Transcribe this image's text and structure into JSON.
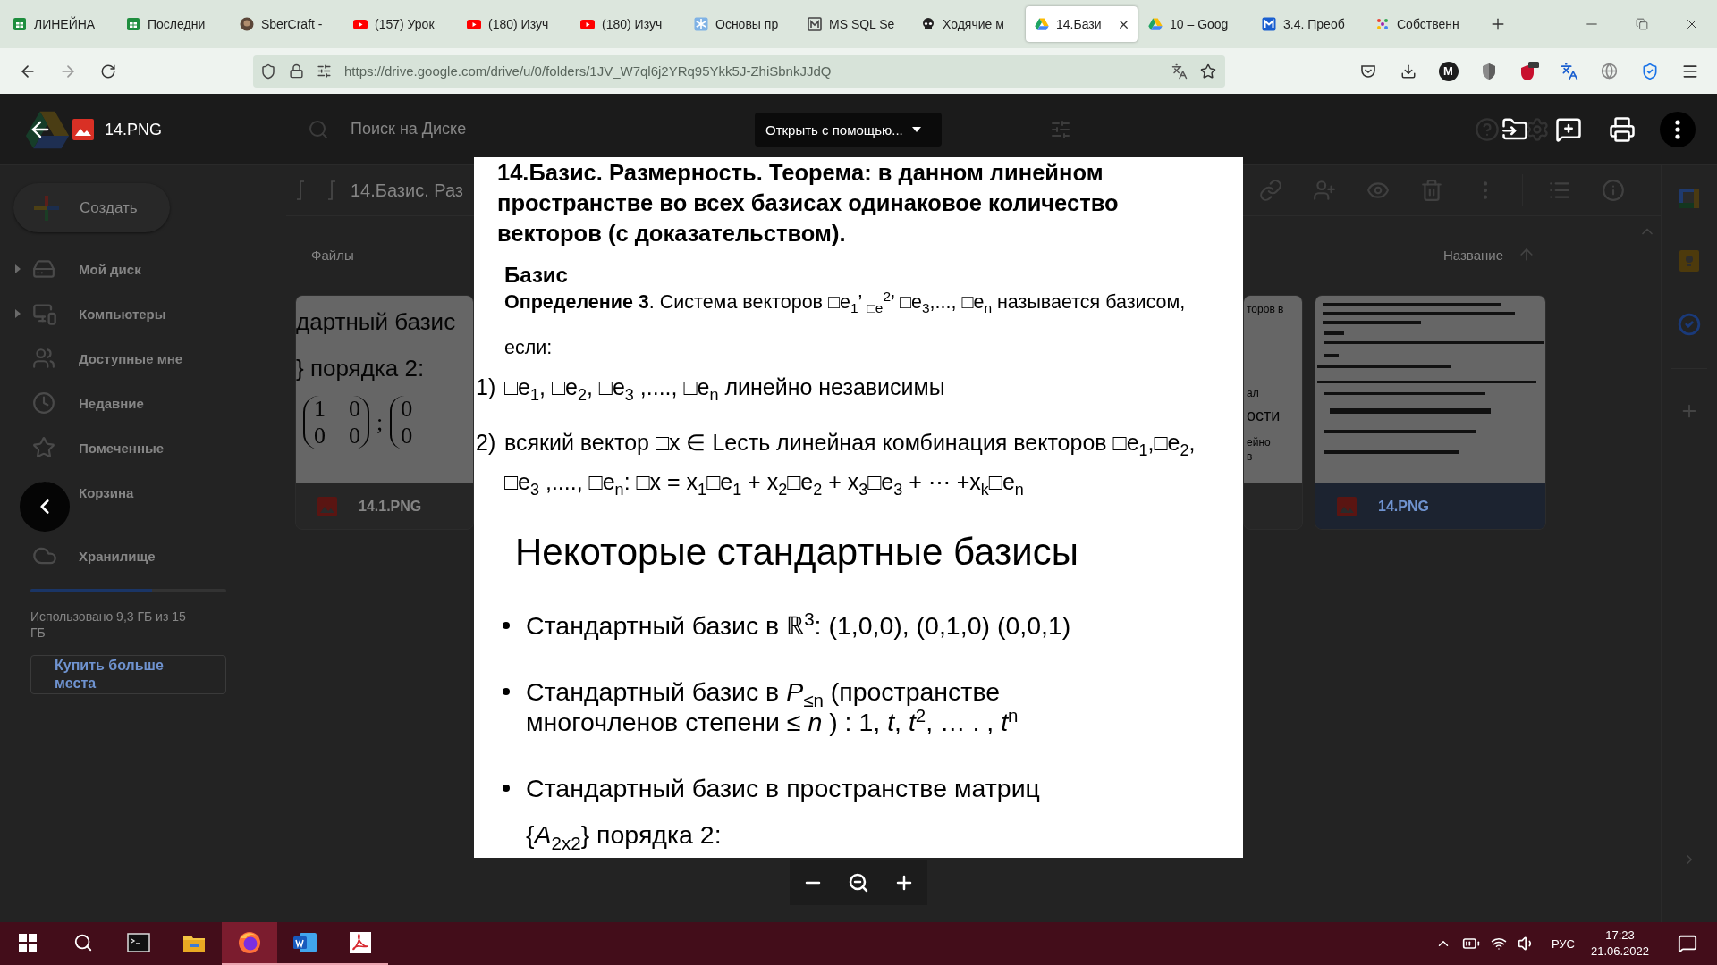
{
  "browser": {
    "tabs": [
      {
        "title": "ЛИНЕЙНА",
        "kind": "sheets",
        "selected": false
      },
      {
        "title": "Последни",
        "kind": "sheets",
        "selected": false
      },
      {
        "title": "SberCraft -",
        "kind": "avatar",
        "selected": false
      },
      {
        "title": "(157) Урок",
        "kind": "video",
        "selected": false
      },
      {
        "title": "(180) Изуч",
        "kind": "video",
        "selected": false
      },
      {
        "title": "(180) Изуч",
        "kind": "video",
        "selected": false
      },
      {
        "title": "Основы пр",
        "kind": "snowflake",
        "selected": false
      },
      {
        "title": "MS SQL Se",
        "kind": "database",
        "selected": false
      },
      {
        "title": "Ходячие м",
        "kind": "skull",
        "selected": false
      },
      {
        "title": "14.Бази",
        "kind": "drive",
        "selected": true
      },
      {
        "title": "10 – Goog",
        "kind": "drive",
        "selected": false
      },
      {
        "title": "3.4. Преоб",
        "kind": "book",
        "selected": false
      },
      {
        "title": "Собственн",
        "kind": "dots",
        "selected": false
      }
    ],
    "url": "https://drive.google.com/drive/u/0/folders/1JV_W7ql6j2YRq95Ykk5J-ZhiSbnkJJdQ",
    "profile_letter": "M"
  },
  "drive": {
    "search": {
      "placeholder": "Поиск на Диске"
    },
    "create_button": "Создать",
    "nav": [
      {
        "label": "Мой диск",
        "kind": "drive",
        "expandable": true
      },
      {
        "label": "Компьютеры",
        "kind": "computers",
        "expandable": true
      },
      {
        "label": "Доступные мне",
        "kind": "shared",
        "expandable": false
      },
      {
        "label": "Недавние",
        "kind": "recent",
        "expandable": false
      },
      {
        "label": "Помеченные",
        "kind": "starred",
        "expandable": false
      },
      {
        "label": "Корзина",
        "kind": "trash",
        "expandable": false
      }
    ],
    "storage": {
      "label": "Хранилище",
      "level": 0.62,
      "usage": "Использовано 9,3 ГБ из 15 ГБ",
      "buy_button": "Купить больше места"
    },
    "folder_title": "14.Базис. Раз",
    "section_label": "Файлы",
    "sort_label": "Название",
    "files": [
      {
        "name": "14.1.PNG",
        "selected": false,
        "preview": {
          "lines": [
            "дартный  базис",
            "} порядка 2:"
          ],
          "matrices": [
            [
              [
                "1",
                "0"
              ],
              [
                "0",
                "0"
              ]
            ],
            [
              [
                "0"
              ],
              [
                "0"
              ]
            ]
          ],
          "separator": ";"
        }
      },
      {
        "name": "14.PNG",
        "selected": true
      }
    ],
    "partial_card": {
      "fragments": [
        {
          "text": "торов в",
          "kind": "small"
        },
        {
          "text": "ал",
          "kind": "small"
        },
        {
          "text": "ости",
          "kind": "large"
        },
        {
          "text": "ейно",
          "kind": "small"
        },
        {
          "text": "в",
          "kind": "small"
        }
      ]
    }
  },
  "viewer": {
    "file_name": "14.PNG",
    "open_with": "Открыть с помощью...",
    "document": {
      "title": "14.Базис. Размерность. Теорема: в данном линейном пространстве во всех базисах одинаковое количество векторов (с доказательством).",
      "heading": "Базис",
      "definition": "**Определение 3**. Система векторов □e$_{1}$’ $_{□e}$$^{2}$’ □e$_{3}$,..., □e$_{n}$ называется базисом,",
      "condition": "если:",
      "items": [
        {
          "marker": "1)",
          "lines": [
            "□e$_{1}$, □e$_{2}$, □e$_{3}$ ,...., □e$_{n}$ линейно независимы"
          ]
        },
        {
          "marker": "2)",
          "lines": [
            "всякий вектор □x ∈  Lесть линейная комбинация векторов □e$_{1}$,□e$_{2}$,",
            "□e$_{3}$ ,...., □e$_{n}$: □x = x$_{1}$□e$_{1}$ + x$_{2}$□e$_{2}$ + x$_{3}$□e$_{3}$ + ⋯  +x$_{k}$□e$_{n}$"
          ]
        }
      ],
      "slide_title": "Некоторые стандартные базисы",
      "bullets": [
        {
          "kind": "bullet",
          "lines": [
            "Стандартный базис в ℝ$^{3}$: (1,0,0), (0,1,0) (0,0,1)"
          ]
        },
        {
          "kind": "bullet",
          "lines": [
            "Стандартный базис в *P*$_{≤n}$ (пространстве",
            "многочленов степени ≤ *n* ) :  1, *t*, *t*$^{2}$, … . , *t*$^{n}$"
          ]
        },
        {
          "kind": "bullet",
          "lines": [
            "Стандартный  базис в пространстве матриц"
          ]
        },
        {
          "kind": "continuation",
          "lines": [
            "{*A*$_{2x2}$} порядка 2:"
          ]
        }
      ]
    }
  },
  "taskbar": {
    "apps": [
      {
        "kind": "terminal",
        "running": false,
        "selected": false
      },
      {
        "kind": "explorer",
        "running": false,
        "selected": false
      },
      {
        "kind": "browser",
        "running": true,
        "selected": true
      },
      {
        "kind": "writer",
        "running": true,
        "selected": false
      },
      {
        "kind": "pdf",
        "running": true,
        "selected": false
      }
    ],
    "language": "РУС",
    "time": "17:23",
    "date": "21.06.2022"
  }
}
